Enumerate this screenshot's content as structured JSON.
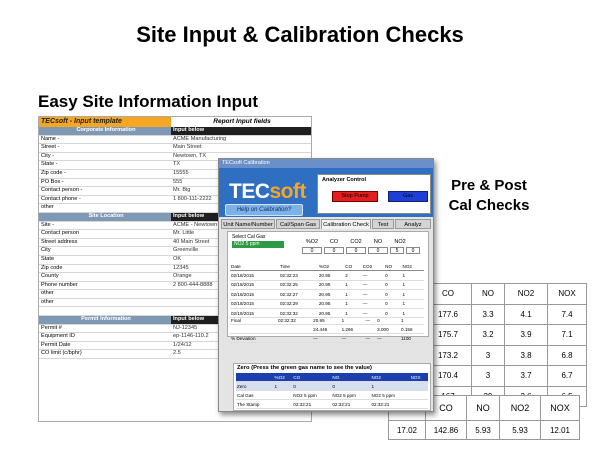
{
  "title": "Site Input & Calibration Checks",
  "left_heading": "Easy Site Information Input",
  "right_heading": [
    "Pre & Post",
    "Cal Checks"
  ],
  "template_sheet": {
    "title": "TECsoft - Input template",
    "title_right": "Report Input fields",
    "rows": [
      {
        "kind": "header",
        "label": "Corporate Information",
        "value": "Input below"
      },
      {
        "label": "Name -",
        "value": "ACME Manufacturing"
      },
      {
        "label": "Street -",
        "value": "Main Street"
      },
      {
        "label": "City -",
        "value": "Newtown, TX"
      },
      {
        "label": "State -",
        "value": "TX"
      },
      {
        "label": "Zip code -",
        "value": "15555"
      },
      {
        "label": "PO Box -",
        "value": "555"
      },
      {
        "label": "Contact person -",
        "value": "Mr. Big"
      },
      {
        "label": "Contact phone -",
        "value": "1 800-111-2222"
      },
      {
        "label": "other",
        "value": ""
      },
      {
        "kind": "header",
        "label": "Site Location",
        "value": "Input below"
      },
      {
        "label": "Site -",
        "value": "ACME - Newtown"
      },
      {
        "label": "Contact person",
        "value": "Mr. Little"
      },
      {
        "label": "Street address",
        "value": "40 Main Street"
      },
      {
        "label": "City",
        "value": "Greenville"
      },
      {
        "label": "State",
        "value": "OK"
      },
      {
        "label": "Zip code",
        "value": "12345"
      },
      {
        "label": "County",
        "value": "Orange"
      },
      {
        "label": "Phone number",
        "value": "2 800-444-8888"
      },
      {
        "label": "other",
        "value": ""
      },
      {
        "label": "other",
        "value": ""
      },
      {
        "kind": "spacer",
        "label": "",
        "value": ""
      },
      {
        "kind": "header",
        "label": "Permit Information",
        "value": "Input below"
      },
      {
        "label": "Permit #",
        "value": "NJ-12345"
      },
      {
        "label": "Equipment ID",
        "value": "ep-1146-110.2"
      },
      {
        "label": "Permit Date",
        "value": "1/24/12"
      },
      {
        "label": "CO limit (c/bphr)",
        "value": "2.5"
      }
    ]
  },
  "calibration_window": {
    "titlebar": "TECsoft Calibration",
    "logo_tec": "TEC",
    "logo_soft": "soft",
    "help_button": "Help on Calibration?",
    "analyzer_title": "Analyzer Control",
    "stop_pump": "Stop Pump",
    "gas": "Gas",
    "tabs": [
      "Unit Name/Number",
      "Cal/Span Gas",
      "Calibration Check",
      "Test",
      "Analyz"
    ],
    "select_label": "Select Cal Gas",
    "select_value": "NO2 5 ppm",
    "mini_headers": [
      "%O2",
      "CO",
      "CO2",
      "NO",
      "NO2"
    ],
    "mini_values": [
      "0",
      "0",
      "0",
      "0",
      "5",
      "0"
    ],
    "table_headers": [
      "Date",
      "Time",
      "%O2",
      "CO",
      "CO2",
      "NO",
      "NO2"
    ],
    "table_rows": [
      [
        "02/18/2015",
        "02:32:23",
        "20.95",
        "2",
        "—",
        "0",
        "1"
      ],
      [
        "02/18/2015",
        "02:32:25",
        "20.95",
        "1",
        "—",
        "0",
        "1"
      ],
      [
        "02/18/2015",
        "02:32:27",
        "20.95",
        "1",
        "—",
        "0",
        "1"
      ],
      [
        "02/18/2015",
        "02:32:29",
        "20.95",
        "1",
        "—",
        "0",
        "1"
      ],
      [
        "02/18/2015",
        "02:32:32",
        "20.95",
        "1",
        "—",
        "0",
        "1"
      ]
    ],
    "final_rows": [
      [
        "Final",
        "02:32:32",
        "20.95",
        "1",
        "—",
        "0",
        "1"
      ],
      [
        "",
        "",
        "24.446",
        "1.266",
        "",
        "3.000",
        "0.156"
      ],
      [
        "% Deviation",
        "",
        "—",
        "—",
        "—",
        "—",
        "1100"
      ]
    ],
    "zero_title": "Zero (Press the green gas name to see the value)",
    "zero_headers": [
      "",
      "%O2",
      "CO",
      "NO",
      "NO2",
      "NOX"
    ],
    "zero_rows": [
      [
        "Zero",
        "1",
        "0",
        "0",
        "1",
        ""
      ],
      [
        "Cal Gas",
        "",
        "NO2 5 ppm",
        "NO2 5 ppm",
        "NO2 5 ppm",
        ""
      ],
      [
        "The Stamp",
        "",
        "02:32:21",
        "02:32:21",
        "02:32:21",
        ""
      ]
    ]
  },
  "results_top": {
    "headers": [
      "CO",
      "NO",
      "NO2",
      "NOX"
    ],
    "rows": [
      [
        "177.6",
        "3.3",
        "4.1",
        "7.4"
      ],
      [
        "175.7",
        "3.2",
        "3.9",
        "7.1"
      ],
      [
        "173.2",
        "3",
        "3.8",
        "6.8"
      ],
      [
        "170.4",
        "3",
        "3.7",
        "6.7"
      ],
      [
        "167",
        "29",
        "3.6",
        "6.5"
      ]
    ]
  },
  "results_bottom": {
    "headers": [
      "",
      "CO",
      "NO",
      "NO2",
      "NOX"
    ],
    "values": [
      "17.02",
      "142.86",
      "5.93",
      "5.93",
      "12.01"
    ]
  }
}
